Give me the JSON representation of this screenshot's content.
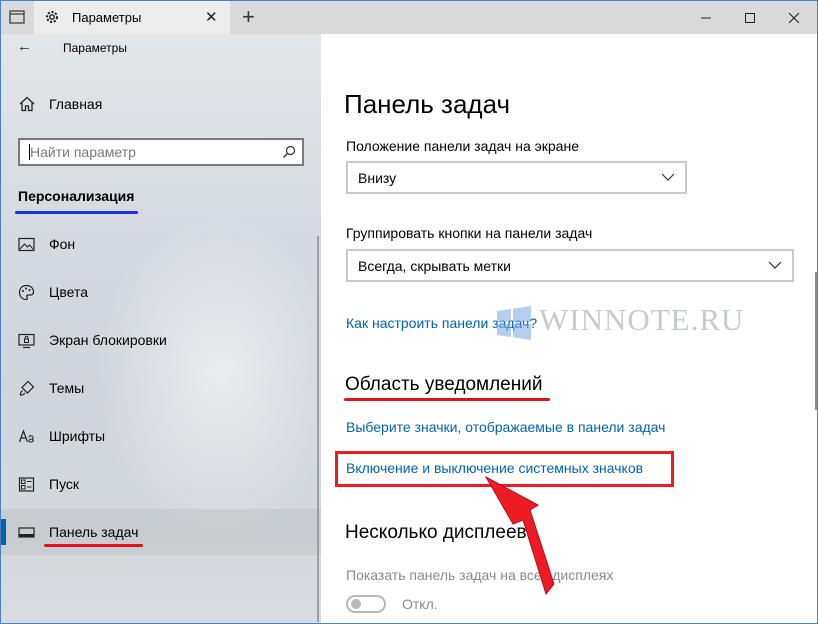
{
  "window": {
    "tab_title": "Параметры"
  },
  "sidebar": {
    "title": "Параметры",
    "home": "Главная",
    "search": {
      "placeholder": "Найти параметр"
    },
    "section": "Персонализация",
    "items": [
      {
        "label": "Фон",
        "icon": "image-icon"
      },
      {
        "label": "Цвета",
        "icon": "palette-icon"
      },
      {
        "label": "Экран блокировки",
        "icon": "lock-screen-icon"
      },
      {
        "label": "Темы",
        "icon": "themes-icon"
      },
      {
        "label": "Шрифты",
        "icon": "fonts-icon"
      },
      {
        "label": "Пуск",
        "icon": "start-icon"
      },
      {
        "label": "Панель задач",
        "icon": "taskbar-icon",
        "active": true
      }
    ]
  },
  "main": {
    "title": "Панель задач",
    "position_label": "Положение панели задач на экране",
    "position_value": "Внизу",
    "group_label": "Группировать кнопки на панели задач",
    "group_value": "Всегда, скрывать метки",
    "customize_link": "Как настроить панели задач?",
    "notify_title": "Область уведомлений",
    "notify_link1": "Выберите значки, отображаемые в панели задач",
    "notify_link2": "Включение и выключение системных значков",
    "multi_title": "Несколько дисплеев",
    "multi_label": "Показать панель задач на всех дисплеях",
    "toggle_state": "Откл."
  },
  "watermark": "WINNOTE.RU",
  "colors": {
    "accent": "#0063b1",
    "highlight": "#ed1c24",
    "section_underline": "#1a2fe0"
  }
}
